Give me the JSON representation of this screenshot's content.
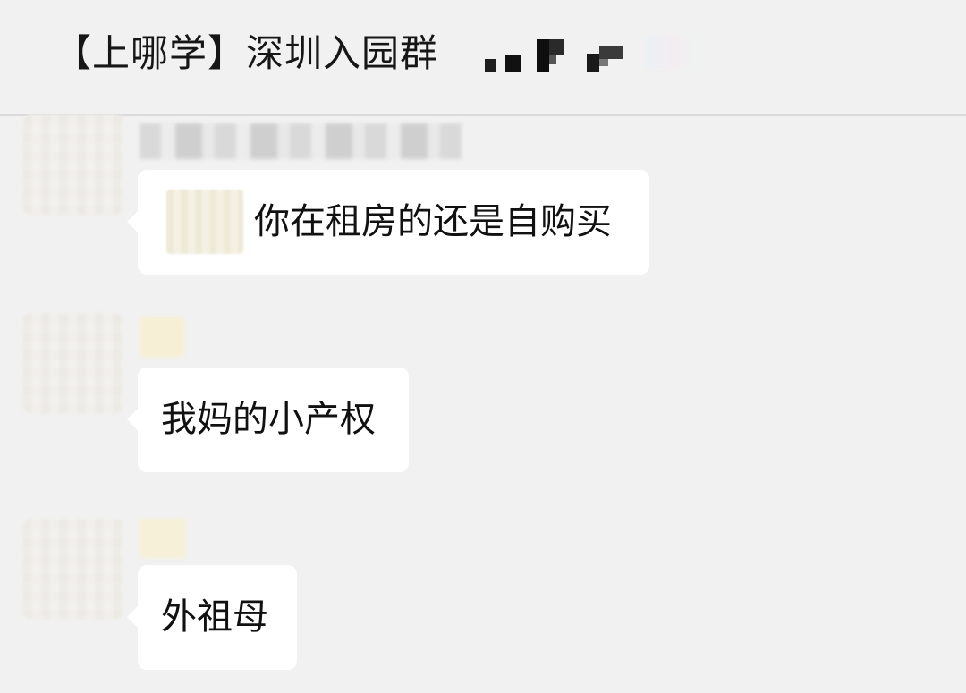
{
  "header": {
    "title": "【上哪学】深圳入园群"
  },
  "messages": [
    {
      "text": "你在租房的还是自购买"
    },
    {
      "text": "我妈的小产权"
    },
    {
      "text": "外祖母"
    }
  ]
}
